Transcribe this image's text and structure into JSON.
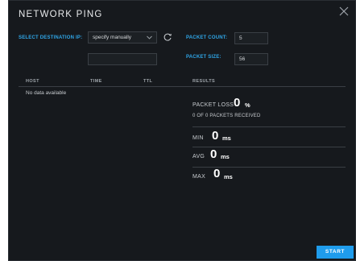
{
  "dialog": {
    "title": "NETWORK PING",
    "close_icon": "close-icon"
  },
  "destination": {
    "label": "SELECT DESTINATION IP:",
    "selected": "specify manually",
    "manual_ip_value": "",
    "refresh_icon": "refresh-icon"
  },
  "packet_count": {
    "label": "PACKET COUNT:",
    "value": "5"
  },
  "packet_size": {
    "label": "PACKET SIZE:",
    "value": "56"
  },
  "table": {
    "columns": [
      "HOST",
      "TIME",
      "TTL",
      "RESULTS"
    ],
    "empty_text": "No data available"
  },
  "results": {
    "packet_loss_label": "PACKET LOSS",
    "packet_loss_value": "0",
    "packet_loss_unit": "%",
    "received_text": "0 OF 0 PACKETS RECEIVED",
    "min_label": "MIN",
    "min_value": "0",
    "min_unit": "ms",
    "avg_label": "AVG",
    "avg_value": "0",
    "avg_unit": "ms",
    "max_label": "MAX",
    "max_value": "0",
    "max_unit": "ms"
  },
  "actions": {
    "start_label": "START"
  },
  "colors": {
    "accent": "#1f9cec",
    "label_blue": "#2fa6e8",
    "background": "#16191d"
  }
}
